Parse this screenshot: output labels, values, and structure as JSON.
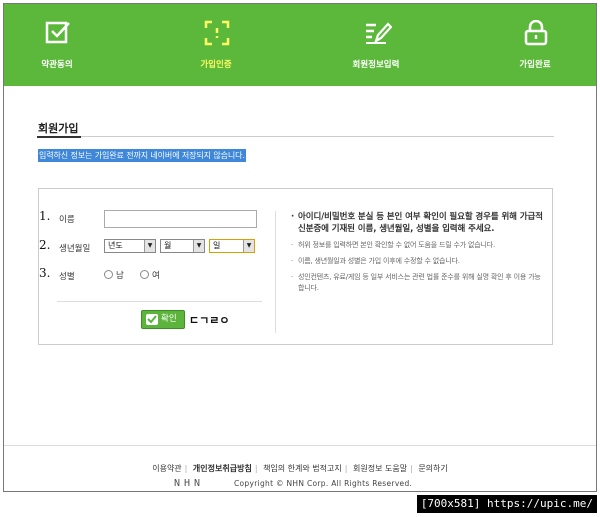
{
  "steps": [
    {
      "label": "약관동의",
      "icon": "check-box-icon"
    },
    {
      "label": "가입인증",
      "icon": "verify-focus-icon"
    },
    {
      "label": "회원정보입력",
      "icon": "pen-write-icon"
    },
    {
      "label": "가입완료",
      "icon": "lock-icon"
    }
  ],
  "active_step": 1,
  "page_title": "회원가입",
  "notice": "입력하신 정보는 가입완료 전까지 네이버에 저장되지 않습니다.",
  "form": {
    "fields": [
      {
        "num": "1.",
        "label": "이름"
      },
      {
        "num": "2.",
        "label": "생년월일"
      },
      {
        "num": "3.",
        "label": "성별"
      }
    ],
    "name_value": "",
    "year": "년도",
    "month": "월",
    "day": "일",
    "gender_options": [
      "남",
      "여"
    ],
    "ok_button": "확인",
    "ok_extra": "ㄷㄱㄹㅇ"
  },
  "info": {
    "main": "아이디/비밀번호 분실 등 본인 여부 확인이 필요할 경우를 위해 가급적 신분증에 기재된 이름, 생년월일, 성별을 입력해 주세요.",
    "subs": [
      "허위 정보를 입력하면 본인 확인할 수 없어 도움을 드릴 수가 없습니다.",
      "이름, 생년월일과 성별은 가입 이후에 수정할 수 없습니다.",
      "성인컨텐츠, 유료/게임 등 일부 서비스는 관련 법률 준수를 위해 실명 확인 후 이용 가능합니다."
    ]
  },
  "footer": {
    "links": [
      "이용약관",
      "개인정보취급방침",
      "책임의 한계와 법적고지",
      "회원정보 도움말",
      "문의하기"
    ],
    "logo": "NHN",
    "copyright": "Copyright © NHN Corp. All Rights Reserved."
  },
  "watermark": "[700x581] https://upic.me/",
  "colors": {
    "brand_green": "#5cb83a",
    "active_step": "#ffff66",
    "notice_bg": "#3f87d8"
  }
}
